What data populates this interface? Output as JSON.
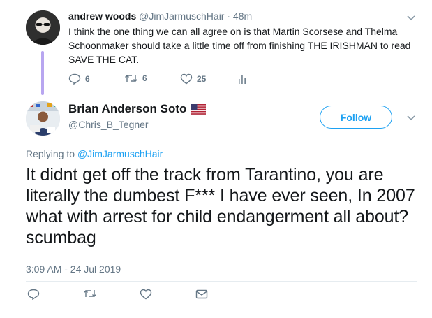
{
  "parent_tweet": {
    "author_name": "andrew woods",
    "author_handle": "@JimJarmuschHair",
    "separator": "·",
    "time": "48m",
    "text": "I think the one thing we can all agree on is that Martin Scorsese and Thelma Schoonmaker should take a little time off from finishing THE IRISHMAN to read SAVE THE CAT.",
    "reply_count": "6",
    "retweet_count": "6",
    "like_count": "25"
  },
  "main_tweet": {
    "author_name": "Brian Anderson Soto",
    "author_flag": "🇺🇸",
    "author_handle": "@Chris_B_Tegner",
    "follow_label": "Follow",
    "replying_prefix": "Replying to",
    "replying_handle": "@JimJarmuschHair",
    "text": "It didnt get off the track from Tarantino, you are literally the dumbest F*** I have ever seen, In 2007 what with arrest for child endangerment all about? scumbag",
    "timestamp": "3:09 AM - 24 Jul 2019"
  },
  "colors": {
    "accent": "#1da1f2",
    "muted": "#657786",
    "thread_line": "#b8a6f0"
  },
  "icons": [
    "reply-icon",
    "retweet-icon",
    "like-icon",
    "analytics-icon",
    "direct-message-icon",
    "chevron-down-icon",
    "us-flag-icon"
  ]
}
